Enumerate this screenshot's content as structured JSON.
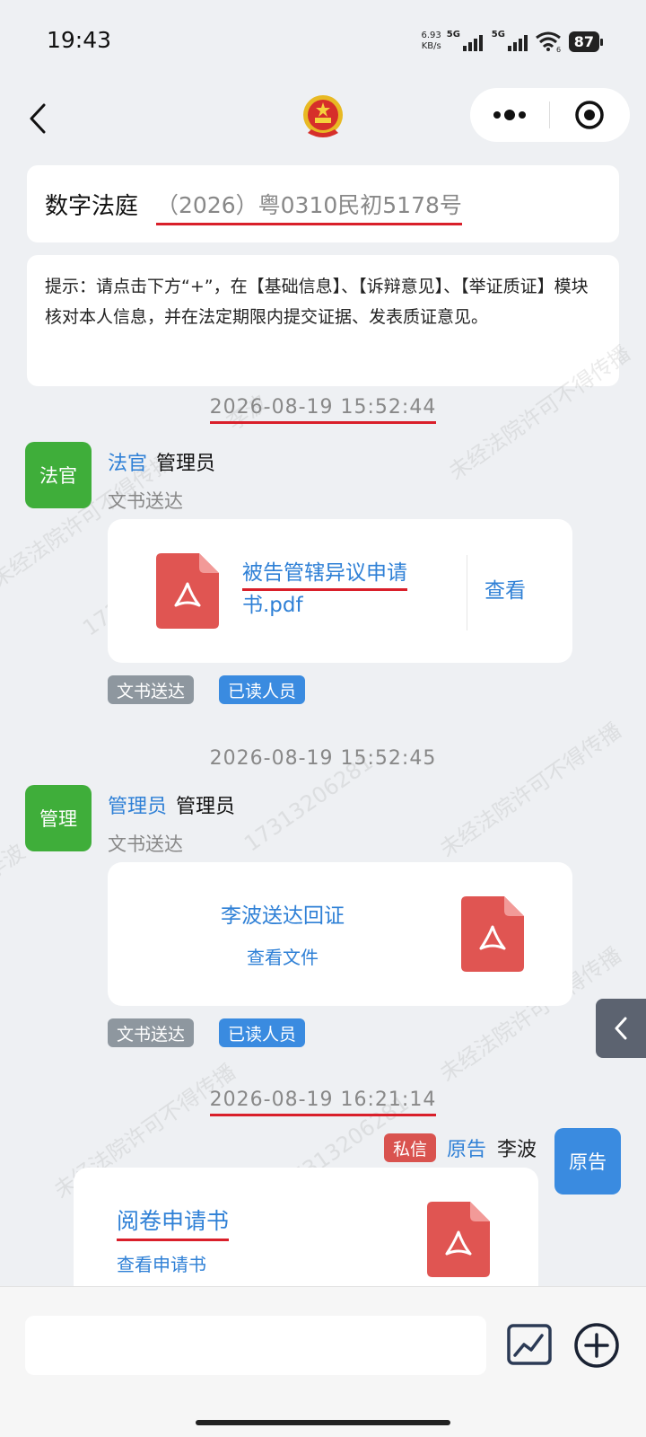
{
  "status": {
    "time": "19:43",
    "speed_value": "6.93",
    "speed_unit": "KB/s",
    "net1": "5G",
    "net2": "5G",
    "wifi_sub": "6",
    "battery": "87"
  },
  "header": {
    "title": "数字法庭",
    "case_number": "（2026）粤0310民初5178号"
  },
  "notice": "提示：请点击下方“+”，在【基础信息】、【诉辩意见】、【举证质证】模块核对本人信息，并在法定期限内提交证据、发表质证意见。",
  "watermark": {
    "a": "未经法院许可不得传播",
    "b": "17313206281",
    "c": "李波"
  },
  "messages": [
    {
      "timestamp": "2026-08-19 15:52:44",
      "avatar_label": "法官",
      "role": "法官",
      "name": "管理员",
      "type": "文书送达",
      "file_name_line1": "被告管辖异议申请",
      "file_name_line2": "书.pdf",
      "action": "查看",
      "tags": [
        "文书送达",
        "已读人员"
      ]
    },
    {
      "timestamp": "2026-08-19 15:52:45",
      "avatar_label": "管理",
      "role": "管理员",
      "name": "管理员",
      "type": "文书送达",
      "file_title": "李波送达回证",
      "action": "查看文件",
      "tags": [
        "文书送达",
        "已读人员"
      ]
    },
    {
      "timestamp": "2026-08-19 16:21:14",
      "avatar_label": "原告",
      "private_tag": "私信",
      "role": "原告",
      "name": "李波",
      "file_title": "阅卷申请书",
      "action": "查看申请书"
    }
  ],
  "input": {
    "placeholder": ""
  },
  "colors": {
    "accent": "#2f80d6",
    "judge_avatar": "#3fae3a",
    "plaintiff_avatar": "#3a8be0",
    "pdf": "#e05552",
    "highlight_underline": "#d91f2a"
  },
  "icons": [
    "back-icon",
    "court-emblem-icon",
    "more-dots-icon",
    "target-icon",
    "pdf-file-icon",
    "chevron-left-icon",
    "image-icon",
    "add-circle-icon"
  ]
}
